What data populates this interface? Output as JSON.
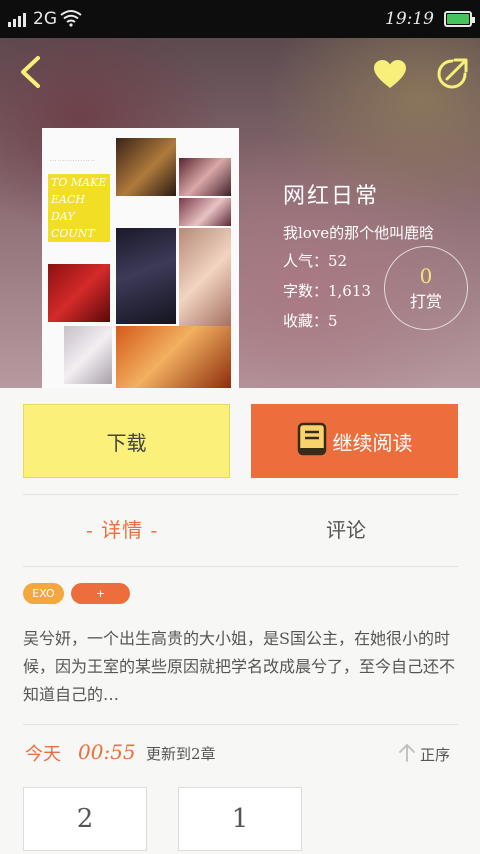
{
  "status_bar": {
    "network": "2G",
    "time": "19:19"
  },
  "book": {
    "title": "网红日常",
    "author": "我love的那个他叫鹿晗",
    "popularity_label": "人气：52",
    "word_count_label": "字数：1,613",
    "favorites_label": "收藏：5",
    "tip_count": "0",
    "tip_label": "打赏",
    "cover_text": "TO MAKE EACH DAY COUNT"
  },
  "actions": {
    "download_label": "下载",
    "continue_label": "继续阅读"
  },
  "tabs": [
    {
      "label": "- 详情 -",
      "active": true
    },
    {
      "label": "评论",
      "active": false
    }
  ],
  "tags": [
    {
      "label": "EXO",
      "color": "#f4a63f"
    },
    {
      "label": "+",
      "color": "#ec6e3d"
    }
  ],
  "description": "吴兮妍，一个出生高贵的大小姐，是S国公主，在她很小的时候，因为王室的某些原因就把学名改成晨兮了，至今自己还不知道自己的…",
  "update": {
    "today_label": "今天",
    "time": "00:55",
    "text": "更新到2章",
    "sort_label": "正序"
  },
  "chapters": [
    "2",
    "1"
  ],
  "colors": {
    "accent": "#ec6e3d",
    "download_bg": "#fbf07a",
    "tag_exo": "#f4a63f",
    "icon_yellow": "#f6ef7a"
  }
}
